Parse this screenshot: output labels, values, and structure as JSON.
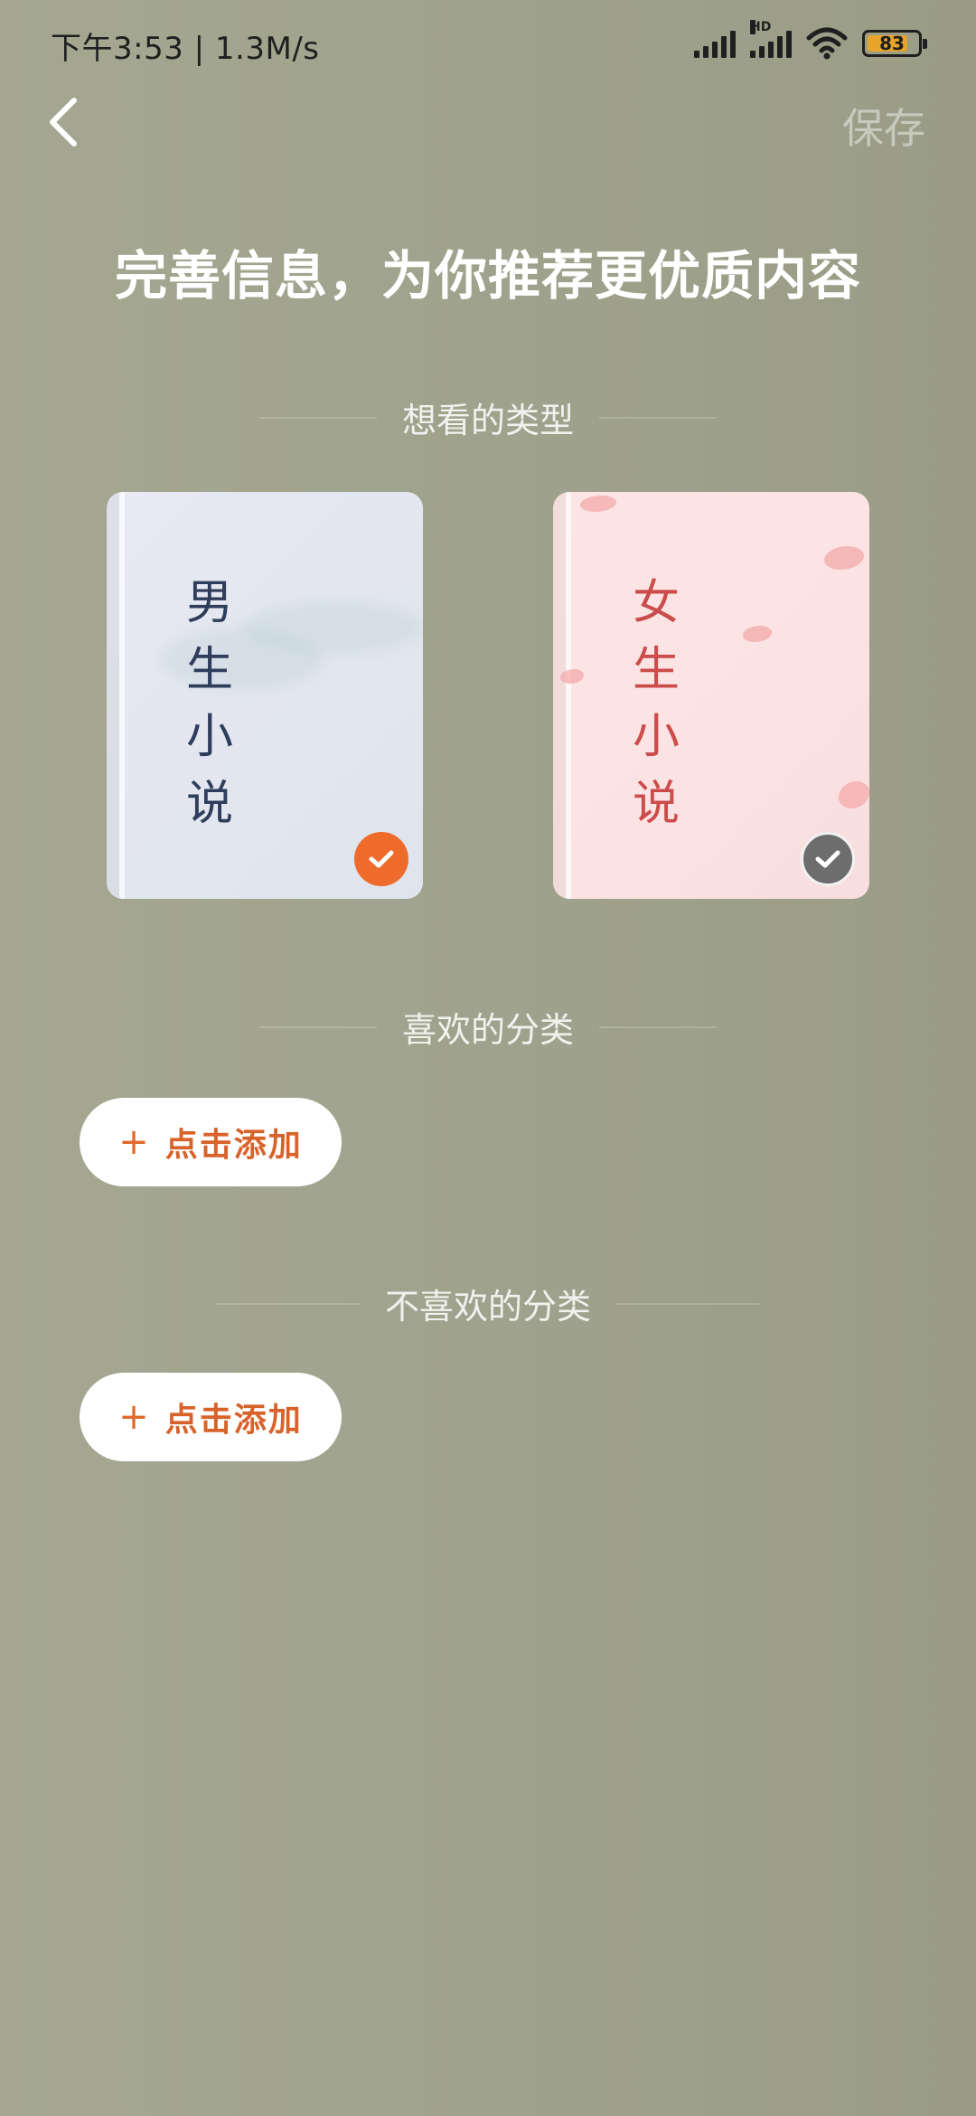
{
  "status_bar": {
    "time_speed": "下午3:53 | 1.3M/s",
    "hd_label": "HD",
    "battery": "83",
    "battery_level": 0.83
  },
  "header": {
    "back_icon": "chevron-left-icon",
    "save_label": "保存"
  },
  "title": "完善信息，为你推荐更优质内容",
  "sections": {
    "types": {
      "label": "想看的类型",
      "cards": [
        {
          "title": "男生小说",
          "selected": true,
          "check_color": "#ef6b2b"
        },
        {
          "title": "女生小说",
          "selected": false,
          "check_color": "#6d6d6d"
        }
      ]
    },
    "liked": {
      "label": "喜欢的分类",
      "add_label": "点击添加",
      "plus": "+"
    },
    "disliked": {
      "label": "不喜欢的分类",
      "add_label": "点击添加",
      "plus": "+"
    }
  },
  "colors": {
    "accent": "#ef6b2b",
    "add_text": "#d8632a",
    "background": "#a0a38d"
  }
}
